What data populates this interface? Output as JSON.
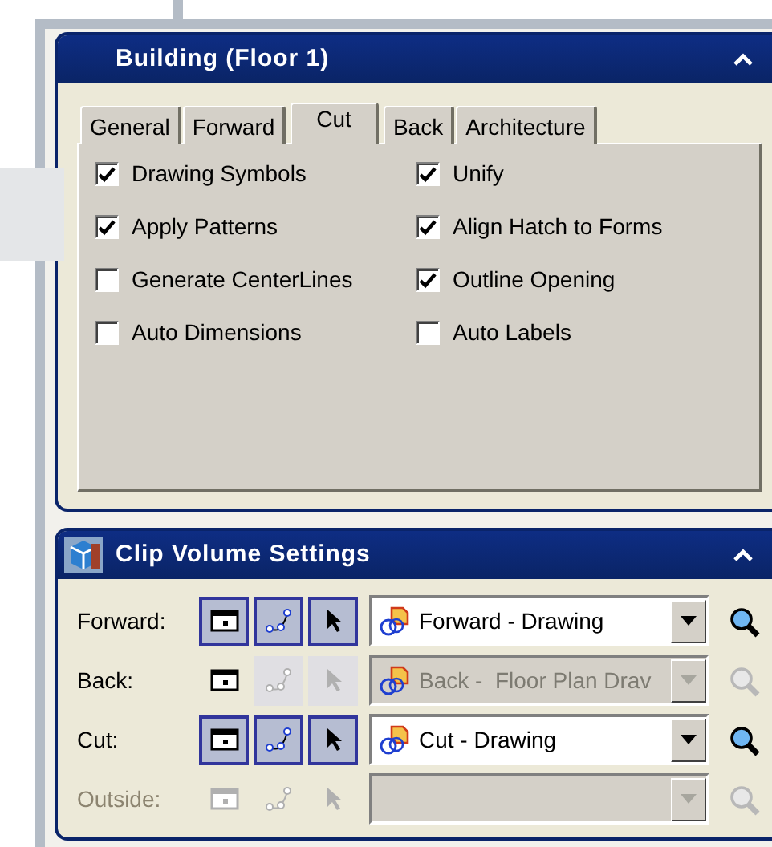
{
  "building_panel": {
    "title": "Building (Floor 1)",
    "tabs": [
      {
        "label": "General",
        "selected": false
      },
      {
        "label": "Forward",
        "selected": false
      },
      {
        "label": "Cut",
        "selected": true
      },
      {
        "label": "Back",
        "selected": false
      },
      {
        "label": "Architecture",
        "selected": false
      }
    ],
    "options": [
      {
        "label": "Drawing Symbols",
        "checked": true
      },
      {
        "label": "Unify",
        "checked": true
      },
      {
        "label": "Apply Patterns",
        "checked": true
      },
      {
        "label": "Align Hatch to Forms",
        "checked": true
      },
      {
        "label": "Generate CenterLines",
        "checked": false
      },
      {
        "label": "Outline Opening",
        "checked": true
      },
      {
        "label": "Auto Dimensions",
        "checked": false
      },
      {
        "label": "Auto Labels",
        "checked": false
      }
    ]
  },
  "clip_panel": {
    "title": "Clip Volume Settings",
    "rows": [
      {
        "label": "Forward:",
        "disabled": false,
        "tools": [
          {
            "kind": "display",
            "pressed": true,
            "disabled": false
          },
          {
            "kind": "path",
            "pressed": true,
            "disabled": false
          },
          {
            "kind": "select",
            "pressed": true,
            "disabled": false
          }
        ],
        "view": {
          "value": "Forward - Drawing",
          "disabled": false
        }
      },
      {
        "label": "Back:",
        "disabled": false,
        "tools": [
          {
            "kind": "display",
            "pressed": false,
            "disabled": false
          },
          {
            "kind": "path",
            "pressed": false,
            "disabled": true
          },
          {
            "kind": "select",
            "pressed": false,
            "disabled": true
          }
        ],
        "view": {
          "value": "Back -  Floor Plan Drav",
          "disabled": true
        }
      },
      {
        "label": "Cut:",
        "disabled": false,
        "tools": [
          {
            "kind": "display",
            "pressed": true,
            "disabled": false
          },
          {
            "kind": "path",
            "pressed": true,
            "disabled": false
          },
          {
            "kind": "select",
            "pressed": true,
            "disabled": false
          }
        ],
        "view": {
          "value": "Cut - Drawing",
          "disabled": false
        }
      },
      {
        "label": "Outside:",
        "disabled": true,
        "tools": [
          {
            "kind": "display",
            "pressed": false,
            "disabled": true
          },
          {
            "kind": "path",
            "pressed": false,
            "disabled": true
          },
          {
            "kind": "select",
            "pressed": false,
            "disabled": true
          }
        ],
        "view": {
          "disabled": true
        }
      }
    ]
  }
}
